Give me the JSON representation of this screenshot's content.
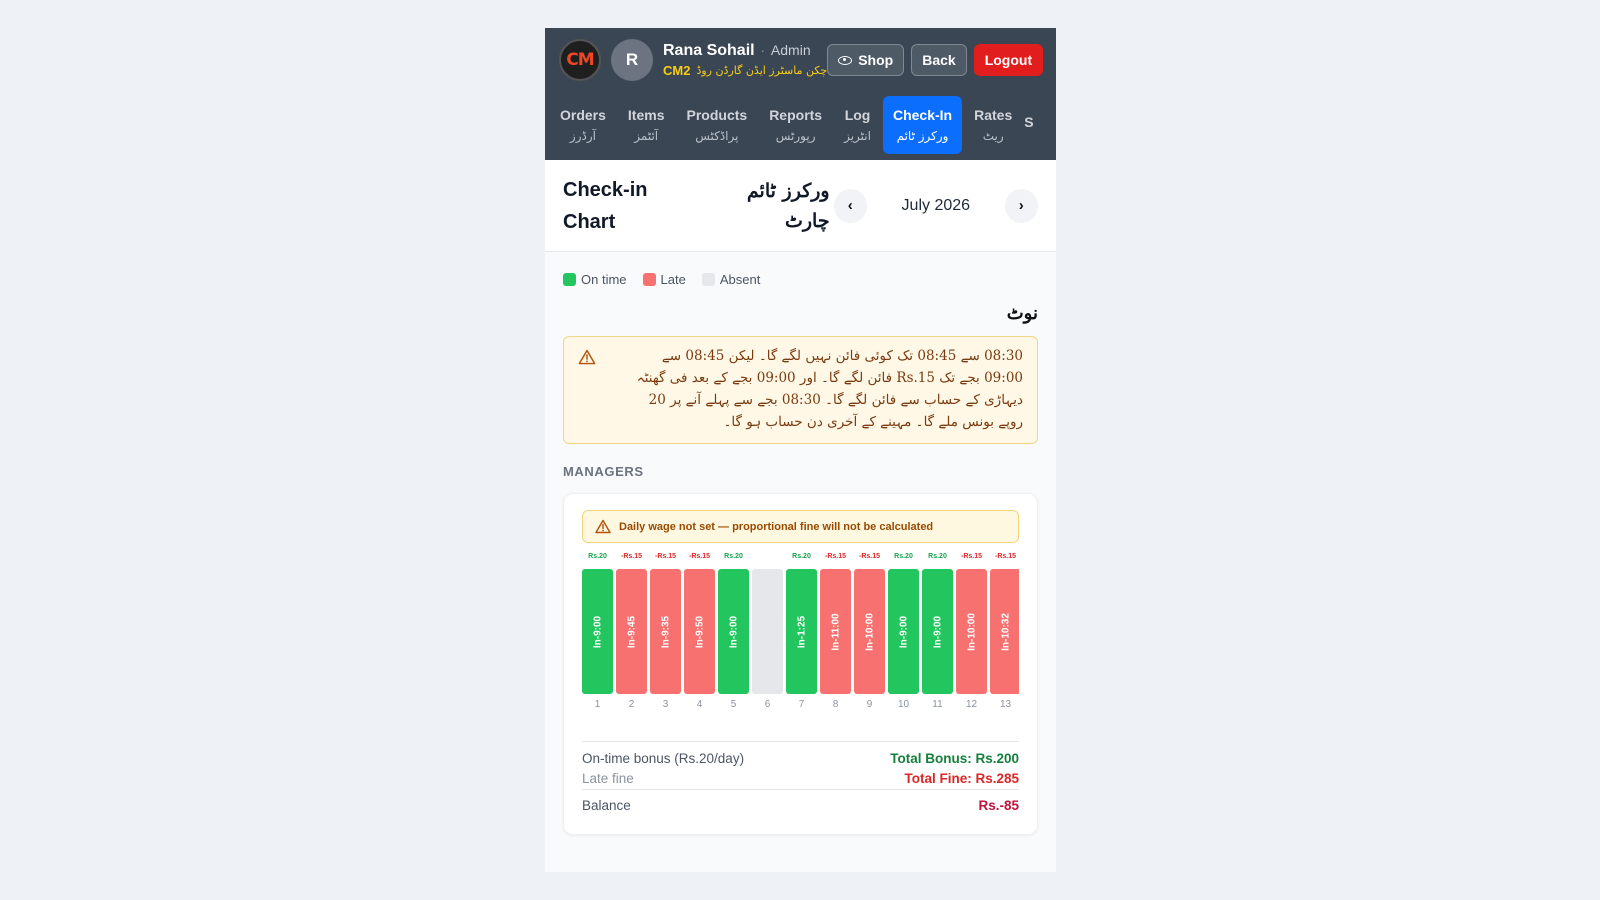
{
  "header": {
    "logo_text": "CM",
    "avatar_initial": "R",
    "user_name": "Rana Sohail",
    "separator": "·",
    "role": "Admin",
    "shop_code": "CM2",
    "shop_name": "چکن ماسٹرز ایڈن گارڈن روڈ",
    "buttons": {
      "shop": "Shop",
      "back": "Back",
      "logout": "Logout"
    }
  },
  "nav": {
    "items": [
      {
        "en": "Orders",
        "ur": "آرڈرز"
      },
      {
        "en": "Items",
        "ur": "آئٹمز"
      },
      {
        "en": "Products",
        "ur": "پراڈکٹس"
      },
      {
        "en": "Reports",
        "ur": "رپورٹس"
      },
      {
        "en": "Log",
        "ur": "انٹریز"
      },
      {
        "en": "Check-In",
        "ur": "ورکرز ٹائم"
      },
      {
        "en": "Rates",
        "ur": "ریٹ"
      },
      {
        "en": "S",
        "ur": ""
      }
    ],
    "active_index": 5
  },
  "page": {
    "title_en": "Check-in Chart",
    "title_ur": "ورکرز ٹائم چارٹ",
    "month": "July 2026",
    "prev_icon": "‹",
    "next_icon": "›"
  },
  "legend": [
    {
      "label": "On time",
      "color": "#22c55e"
    },
    {
      "label": "Late",
      "color": "#f87171"
    },
    {
      "label": "Absent",
      "color": "#e5e7eb"
    }
  ],
  "note": {
    "title": "نوٹ",
    "text": "08:30 سے 08:45 تک کوئی فائن نہیں لگے گا۔ لیکن 08:45 سے 09:00 بجے تک Rs.15 فائن لگے گا۔ اور 09:00 بجے کے بعد فی گھنٹہ دیہاڑی کے حساب سے فائن لگے گا۔ 08:30 بجے سے پہلے آنے پر 20 روپے بونس ملے گا۔ مہینے کے آخری دن حساب ہو گا۔"
  },
  "section_label": "MANAGERS",
  "card": {
    "wage_warning": "Daily wage not set — proportional fine will not be calculated",
    "summary": {
      "bonus_label": "On-time bonus (Rs.20/day)",
      "bonus_value": "Total Bonus: Rs.200",
      "fine_label": "Late fine",
      "fine_value": "Total Fine: Rs.285",
      "balance_label": "Balance",
      "balance_value": "Rs.-85"
    }
  },
  "chart_data": {
    "type": "bar",
    "days": [
      {
        "day": 1,
        "status": "on_time",
        "checkin": "In-9:00",
        "amount": "Rs.20"
      },
      {
        "day": 2,
        "status": "late",
        "checkin": "In-9:45",
        "amount": "-Rs.15"
      },
      {
        "day": 3,
        "status": "late",
        "checkin": "In-9:35",
        "amount": "-Rs.15"
      },
      {
        "day": 4,
        "status": "late",
        "checkin": "In-9:50",
        "amount": "-Rs.15"
      },
      {
        "day": 5,
        "status": "on_time",
        "checkin": "In-9:00",
        "amount": "Rs.20"
      },
      {
        "day": 6,
        "status": "absent",
        "checkin": "",
        "amount": ""
      },
      {
        "day": 7,
        "status": "on_time",
        "checkin": "In-1:25",
        "amount": "Rs.20"
      },
      {
        "day": 8,
        "status": "late",
        "checkin": "In-11:00",
        "amount": "-Rs.15"
      },
      {
        "day": 9,
        "status": "late",
        "checkin": "In-10:00",
        "amount": "-Rs.15"
      },
      {
        "day": 10,
        "status": "on_time",
        "checkin": "In-9:00",
        "amount": "Rs.20"
      },
      {
        "day": 11,
        "status": "on_time",
        "checkin": "In-9:00",
        "amount": "Rs.20"
      },
      {
        "day": 12,
        "status": "late",
        "checkin": "In-10:00",
        "amount": "-Rs.15"
      },
      {
        "day": 13,
        "status": "late",
        "checkin": "In-10:32",
        "amount": "-Rs.15"
      }
    ],
    "colors": {
      "on_time": "#22c55e",
      "late": "#f87171",
      "absent": "#e5e7eb",
      "bonus_text": "#16a34a",
      "fine_text": "#dc2626"
    }
  }
}
